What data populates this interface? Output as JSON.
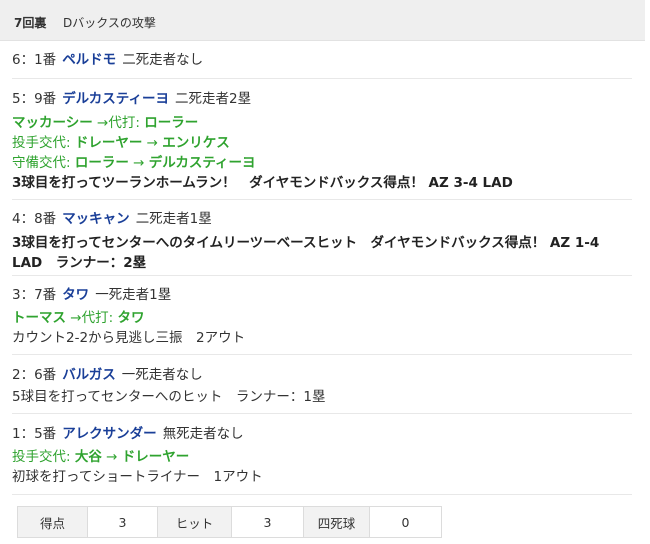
{
  "header": {
    "inning": "7回裏",
    "attack": "Dバックスの攻撃"
  },
  "plays": [
    {
      "pa": {
        "num": "6：1番",
        "name": "ペルドモ",
        "situation": "二死走者なし"
      },
      "lines": []
    },
    {
      "pa": {
        "num": "5：9番",
        "name": "デルカスティーヨ",
        "situation": "二死走者2塁"
      },
      "subs": [
        {
          "label": "マッカーシー",
          "arrow": "→代打:",
          "to": "ローラー"
        },
        {
          "label": "投手交代:",
          "from": "ドレーヤー",
          "arrow": "→",
          "to": "エンリケス"
        },
        {
          "label": "守備交代:",
          "from": "ローラー",
          "arrow": "→",
          "to": "デルカスティーヨ"
        }
      ],
      "result": "3球目を打ってツーランホームラン！　ダイヤモンドバックス得点！ AZ 3-4 LAD"
    },
    {
      "pa": {
        "num": "4：8番",
        "name": "マッキャン",
        "situation": "二死走者1塁"
      },
      "result_line1": "3球目を打ってセンターへのタイムリーツーベースヒット　ダイヤモンドバックス得点！ AZ 1-4",
      "result_line2": "LAD　ランナー：2塁"
    },
    {
      "pa": {
        "num": "3：7番",
        "name": "タワ",
        "situation": "一死走者1塁"
      },
      "subs": [
        {
          "label": "トーマス",
          "arrow": "→代打:",
          "to": "タワ"
        }
      ],
      "result": "カウント2-2から見逃し三振　2アウト"
    },
    {
      "pa": {
        "num": "2：6番",
        "name": "バルガス",
        "situation": "一死走者なし"
      },
      "result": "5球目を打ってセンターへのヒット　ランナー：1塁"
    },
    {
      "pa": {
        "num": "1：5番",
        "name": "アレクサンダー",
        "situation": "無死走者なし"
      },
      "subs": [
        {
          "label": "投手交代:",
          "from": "大谷",
          "arrow": "→",
          "to": "ドレーヤー"
        }
      ],
      "result": "初球を打ってショートライナー　1アウト"
    }
  ],
  "stats": {
    "runs_label": "得点",
    "runs": "3",
    "hits_label": "ヒット",
    "hits": "3",
    "walks_label": "四死球",
    "walks": "0"
  }
}
